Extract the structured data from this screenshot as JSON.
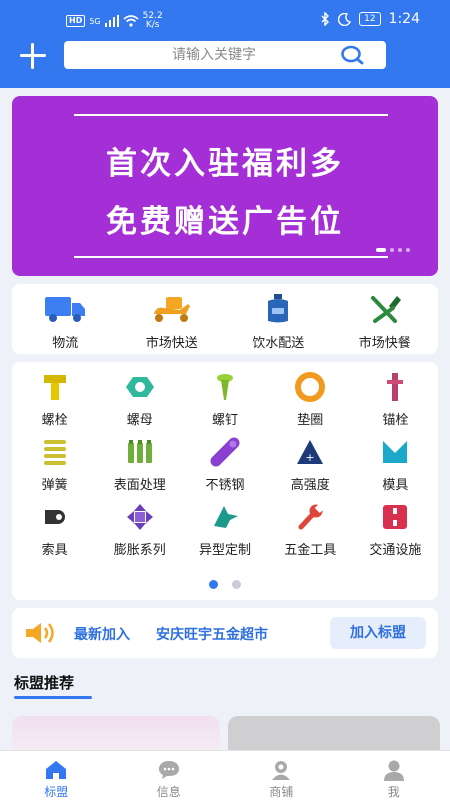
{
  "status_bar": {
    "hd": "HD",
    "network": "5G",
    "speed_value": "52.2",
    "speed_unit": "K/s",
    "battery": "12",
    "time": "1:24"
  },
  "search": {
    "placeholder": "请输入关键字"
  },
  "banner": {
    "line1": "首次入驻福利多",
    "line2": "免费赠送广告位",
    "background": "#a42fd6"
  },
  "services": [
    {
      "label": "物流",
      "icon": "truck-icon"
    },
    {
      "label": "市场快送",
      "icon": "delivery-scooter-icon"
    },
    {
      "label": "饮水配送",
      "icon": "water-bottle-icon"
    },
    {
      "label": "市场快餐",
      "icon": "fork-knife-icon"
    }
  ],
  "categories": [
    {
      "label": "螺栓",
      "icon": "bolt-icon"
    },
    {
      "label": "螺母",
      "icon": "nut-icon"
    },
    {
      "label": "螺钉",
      "icon": "screw-icon"
    },
    {
      "label": "垫圈",
      "icon": "washer-icon"
    },
    {
      "label": "锚栓",
      "icon": "anchor-bolt-icon"
    },
    {
      "label": "弹簧",
      "icon": "spring-icon"
    },
    {
      "label": "表面处理",
      "icon": "surface-treatment-icon"
    },
    {
      "label": "不锈钢",
      "icon": "steel-bar-icon"
    },
    {
      "label": "高强度",
      "icon": "high-strength-icon"
    },
    {
      "label": "模具",
      "icon": "mold-icon"
    },
    {
      "label": "索具",
      "icon": "rigging-hook-icon"
    },
    {
      "label": "膨胀系列",
      "icon": "expansion-icon"
    },
    {
      "label": "异型定制",
      "icon": "custom-shape-icon"
    },
    {
      "label": "五金工具",
      "icon": "wrench-icon"
    },
    {
      "label": "交通设施",
      "icon": "traffic-facility-icon"
    }
  ],
  "notice": {
    "prefix": "最新加入",
    "text": "安庆旺宇五金超市",
    "button": "加入标盟"
  },
  "section": {
    "title": "标盟推荐"
  },
  "bottom_nav": [
    {
      "label": "标盟",
      "icon": "home-icon",
      "active": true
    },
    {
      "label": "信息",
      "icon": "message-icon",
      "active": false
    },
    {
      "label": "商铺",
      "icon": "shop-icon",
      "active": false
    },
    {
      "label": "我",
      "icon": "user-icon",
      "active": false
    }
  ],
  "colors": {
    "primary": "#3478f0",
    "banner": "#a42fd6"
  }
}
